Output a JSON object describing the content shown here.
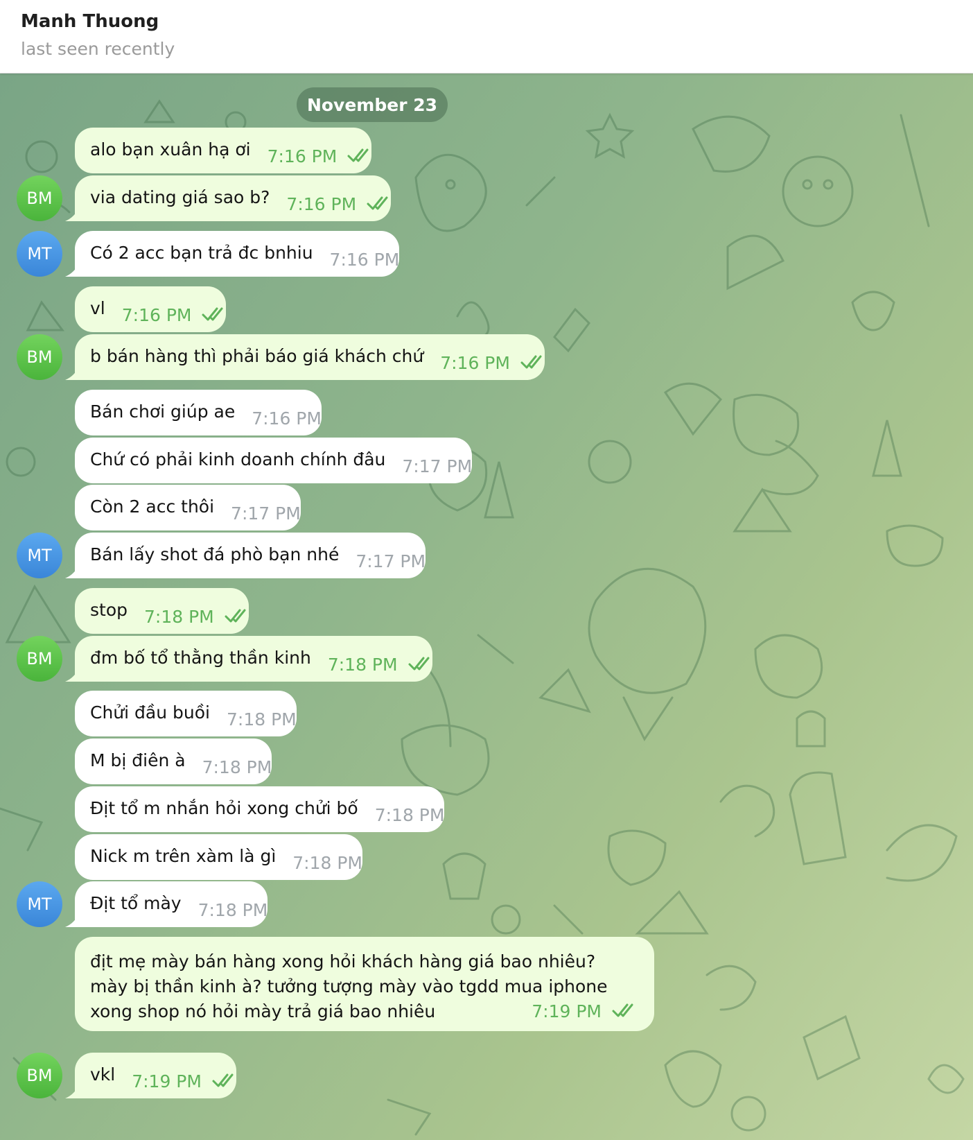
{
  "header": {
    "name": "Manh Thuong",
    "status": "last seen recently"
  },
  "date_separator": "November 23",
  "avatars": {
    "bm": "BM",
    "mt": "MT"
  },
  "colors": {
    "outgoing_bubble": "#effdde",
    "incoming_bubble": "#ffffff",
    "outgoing_time": "#5fb35a",
    "incoming_time": "#a0a6ab",
    "avatar_bm": "#4ab43b",
    "avatar_mt": "#3a86d8"
  },
  "messages": [
    {
      "text": "alo bạn xuân hạ ơi",
      "time": "7:16 PM",
      "dir": "out",
      "read": true
    },
    {
      "text": "via dating giá sao b?",
      "time": "7:16 PM",
      "dir": "out",
      "read": true,
      "avatar": "BM"
    },
    {
      "text": "Có 2 acc bạn trả đc bnhiu",
      "time": "7:16 PM",
      "dir": "in",
      "avatar": "MT"
    },
    {
      "text": "vl",
      "time": "7:16 PM",
      "dir": "out",
      "read": true
    },
    {
      "text": "b bán hàng thì phải báo giá khách chứ",
      "time": "7:16 PM",
      "dir": "out",
      "read": true,
      "avatar": "BM"
    },
    {
      "text": "Bán chơi giúp ae",
      "time": "7:16 PM",
      "dir": "in"
    },
    {
      "text": "Chứ có phải kinh doanh chính đâu",
      "time": "7:17 PM",
      "dir": "in"
    },
    {
      "text": "Còn 2 acc thôi",
      "time": "7:17 PM",
      "dir": "in"
    },
    {
      "text": "Bán lấy shot đá phò bạn nhé",
      "time": "7:17 PM",
      "dir": "in",
      "avatar": "MT"
    },
    {
      "text": "stop",
      "time": "7:18 PM",
      "dir": "out",
      "read": true
    },
    {
      "text": "đm bố tổ thằng thần kinh",
      "time": "7:18 PM",
      "dir": "out",
      "read": true,
      "avatar": "BM"
    },
    {
      "text": "Chửi đầu buồi",
      "time": "7:18 PM",
      "dir": "in"
    },
    {
      "text": "M bị điên à",
      "time": "7:18 PM",
      "dir": "in"
    },
    {
      "text": "Địt tổ m nhắn hỏi xong chửi bố",
      "time": "7:18 PM",
      "dir": "in"
    },
    {
      "text": "Nick m trên xàm là gì",
      "time": "7:18 PM",
      "dir": "in"
    },
    {
      "text": "Địt tổ mày",
      "time": "7:18 PM",
      "dir": "in",
      "avatar": "MT"
    },
    {
      "text": "địt mẹ mày bán hàng xong hỏi khách hàng giá bao nhiêu? mày bị thần kinh à? tưởng tượng mày vào tgdd mua iphone xong shop nó hỏi mày trả giá bao nhiêu",
      "time": "7:19 PM",
      "dir": "out",
      "read": true
    },
    {
      "text": "vkl",
      "time": "7:19 PM",
      "dir": "out",
      "read": true,
      "avatar": "BM"
    }
  ]
}
